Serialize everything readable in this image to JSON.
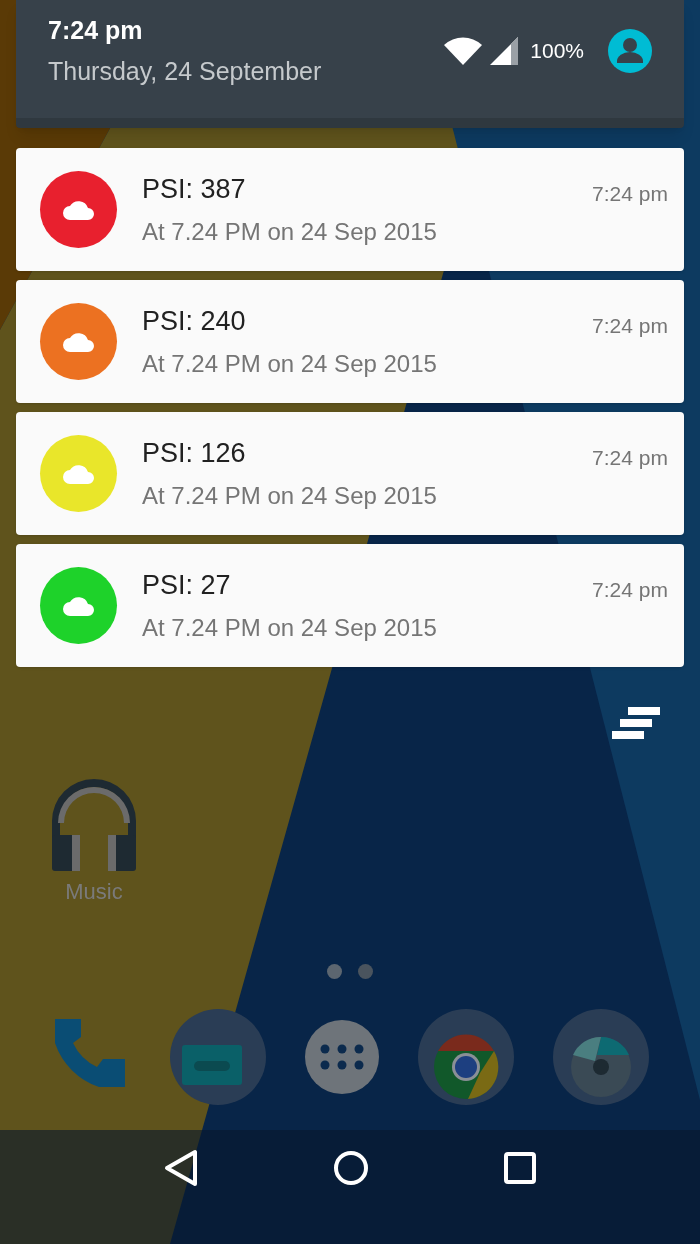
{
  "quick_header": {
    "time": "7:24 pm",
    "date": "Thursday, 24 September",
    "battery": "100%"
  },
  "notifications": [
    {
      "title": "PSI: 387",
      "text": "At 7.24 PM on 24 Sep 2015",
      "time": "7:24 pm",
      "color": "#e8202e"
    },
    {
      "title": "PSI: 240",
      "text": "At 7.24 PM on 24 Sep 2015",
      "time": "7:24 pm",
      "color": "#ec7121"
    },
    {
      "title": "PSI: 126",
      "text": "At 7.24 PM on 24 Sep 2015",
      "time": "7:24 pm",
      "color": "#e9e62a"
    },
    {
      "title": "PSI: 27",
      "text": "At 7.24 PM on 24 Sep 2015",
      "time": "7:24 pm",
      "color": "#1ed22a"
    }
  ],
  "home": {
    "app_label": "Music"
  }
}
